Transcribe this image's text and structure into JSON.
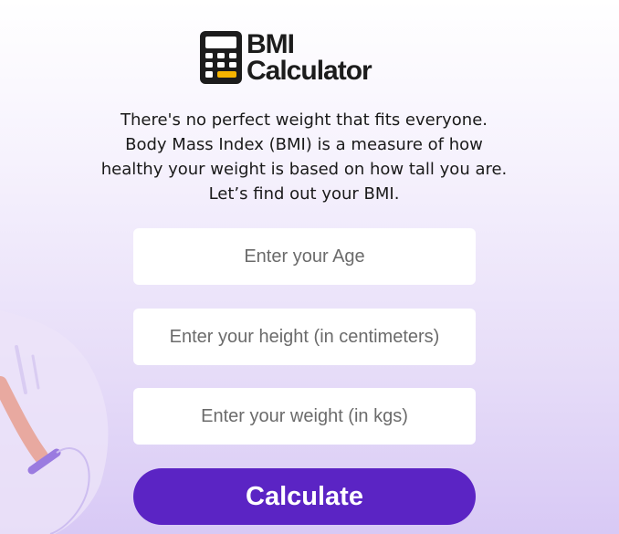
{
  "app": {
    "logo_line1": "BMI",
    "logo_line2": "Calculator",
    "logo_icon": "calculator-icon",
    "accent_color": "#5b24c4"
  },
  "intro": {
    "text": "There's no perfect weight that fits everyone. Body Mass Index (BMI) is a measure of how healthy your weight is based on how tall you are. Let’s find out your BMI."
  },
  "form": {
    "age": {
      "placeholder": "Enter your Age",
      "value": ""
    },
    "height": {
      "placeholder": "Enter your height (in centimeters)",
      "value": ""
    },
    "weight": {
      "placeholder": "Enter your weight (in kgs)",
      "value": ""
    },
    "calculate_label": "Calculate"
  }
}
